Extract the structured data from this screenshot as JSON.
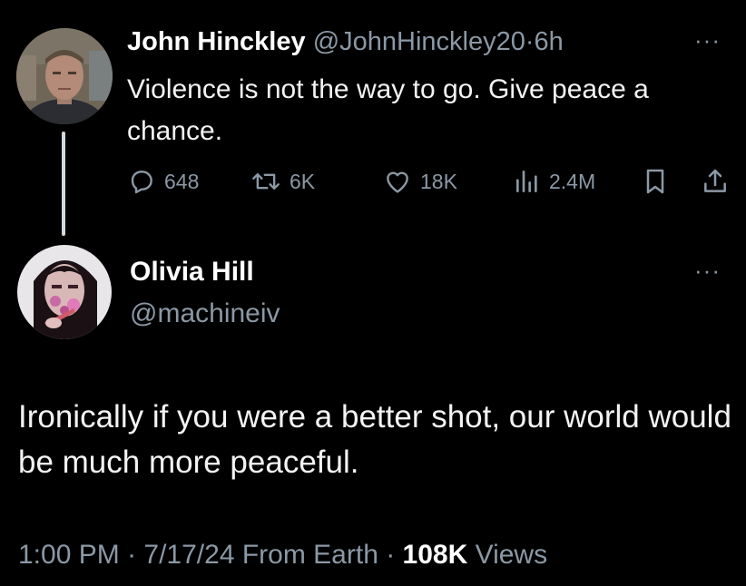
{
  "parent_tweet": {
    "author_name": "John Hinckley",
    "author_handle": "@JohnHinckley20",
    "separator": "·",
    "time_ago": "6h",
    "more_icon": "more-horizontal-icon",
    "text": "Violence is not the way to go. Give peace a chance.",
    "actions": {
      "replies": "648",
      "reposts": "6K",
      "likes": "18K",
      "views": "2.4M"
    }
  },
  "reply_tweet": {
    "author_name": "Olivia Hill",
    "author_handle": "@machineiv",
    "more_icon": "more-horizontal-icon",
    "text": "Ironically if you were a better shot, our world would be much more peaceful.",
    "time": "1:00 PM",
    "separator_1": " · ",
    "date": "7/17/24",
    "source": "From Earth",
    "separator_2": " · ",
    "views_count": "108K",
    "views_label": "Views"
  },
  "colors": {
    "background": "#000000",
    "primary_text": "#e7e9ea",
    "secondary_text": "#8b98a5",
    "thread_line": "#cfd9de"
  }
}
